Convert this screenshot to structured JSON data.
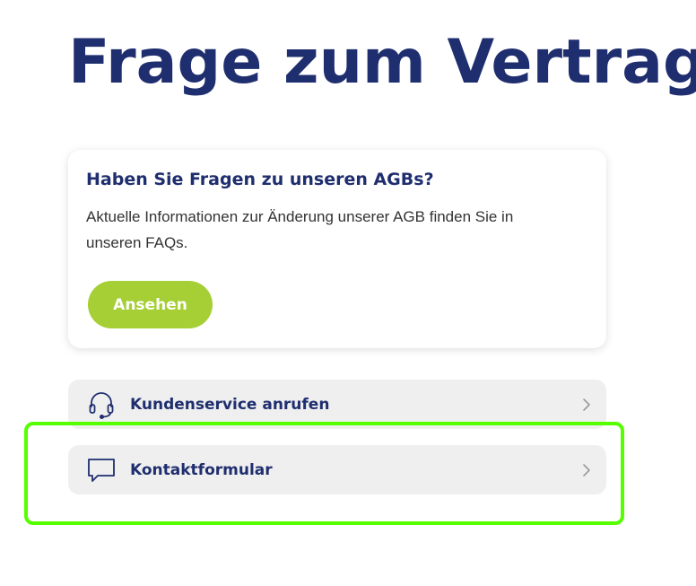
{
  "page": {
    "title": "Frage zum Vertrag"
  },
  "agb_card": {
    "heading": "Haben Sie Fragen zu unseren AGBs?",
    "text": "Aktuelle Informationen zur Änderung unserer AGB finden Sie in unseren FAQs.",
    "button_label": "Ansehen"
  },
  "contact_links": [
    {
      "label": "Kundenservice anrufen",
      "icon": "headset-icon"
    },
    {
      "label": "Kontaktformular",
      "icon": "chat-bubble-icon"
    }
  ],
  "colors": {
    "primary_navy": "#1f2e6e",
    "accent_green": "#a5cf34",
    "highlight_green": "#55ff00",
    "link_background": "#efefef"
  }
}
